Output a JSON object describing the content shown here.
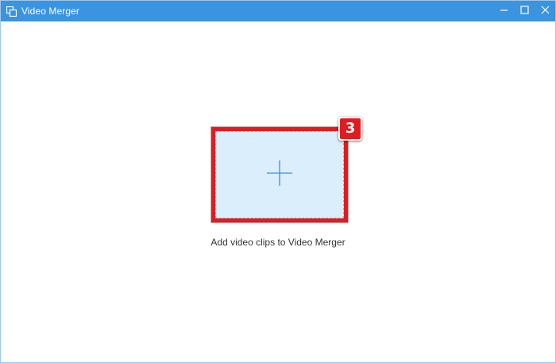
{
  "window": {
    "title": "Video Merger",
    "icons": {
      "app": "video-merger-icon",
      "minimize": "minimize-icon",
      "maximize": "maximize-icon",
      "close": "close-icon"
    },
    "titlebar_color": "#3b94e0"
  },
  "main": {
    "add_icon": "plus-icon",
    "add_area_color": "#dbeefb",
    "caption": "Add video clips to Video Merger"
  },
  "annotation": {
    "step_number": "3",
    "highlight_color": "#e11b22"
  }
}
